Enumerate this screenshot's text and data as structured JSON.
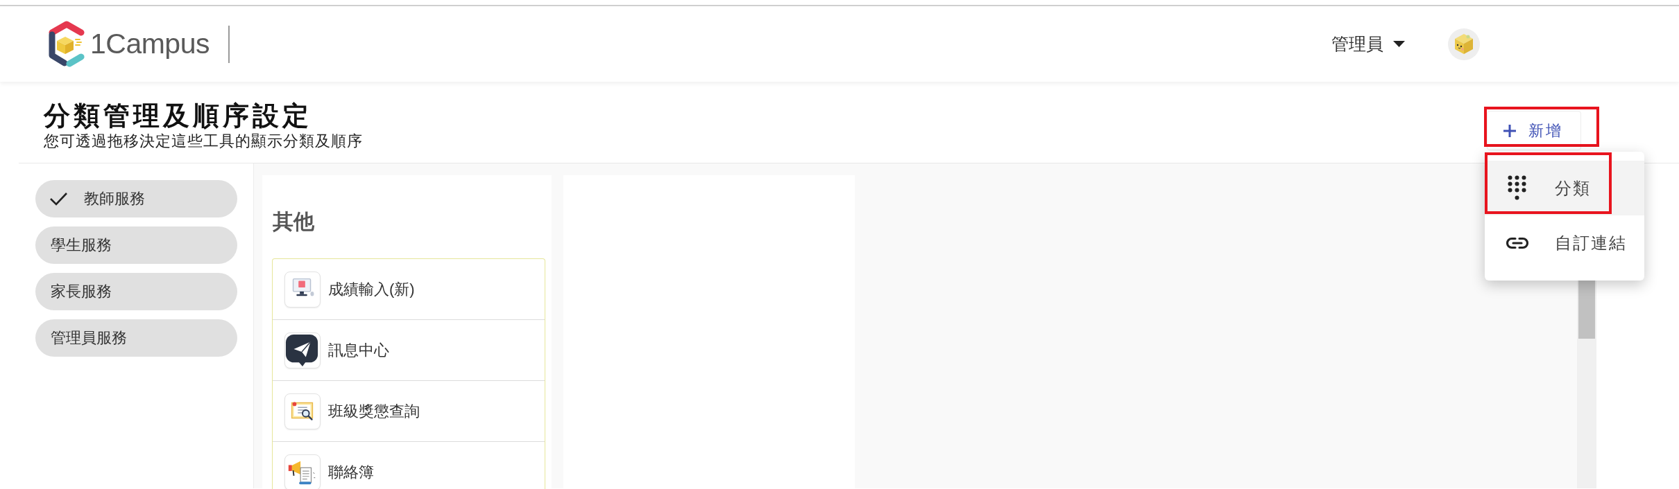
{
  "header": {
    "logo_text": "1Campus",
    "user_menu": {
      "label": "管理員"
    }
  },
  "page_header": {
    "title": "分類管理及順序設定",
    "subtitle": "您可透過拖移決定這些工具的顯示分類及順序",
    "add_button": {
      "label": "新增",
      "annotated": true
    }
  },
  "add_menu": {
    "items": [
      {
        "kind": "category",
        "label": "分類",
        "selected": true,
        "annotated": true
      },
      {
        "kind": "link",
        "label": "自訂連結",
        "selected": false,
        "annotated": false
      }
    ]
  },
  "sidebar": {
    "items": [
      {
        "label": "教師服務",
        "selected": true
      },
      {
        "label": "學生服務",
        "selected": false
      },
      {
        "label": "家長服務",
        "selected": false
      },
      {
        "label": "管理員服務",
        "selected": false
      }
    ]
  },
  "category_columns": [
    {
      "title": "其他",
      "tools": [
        {
          "kind": "monitor",
          "label": "成績輸入(新)"
        },
        {
          "kind": "plane",
          "label": "訊息中心"
        },
        {
          "kind": "record",
          "label": "班級獎懲查詢"
        },
        {
          "kind": "megaphone",
          "label": "聯絡簿"
        }
      ]
    },
    {}
  ]
}
